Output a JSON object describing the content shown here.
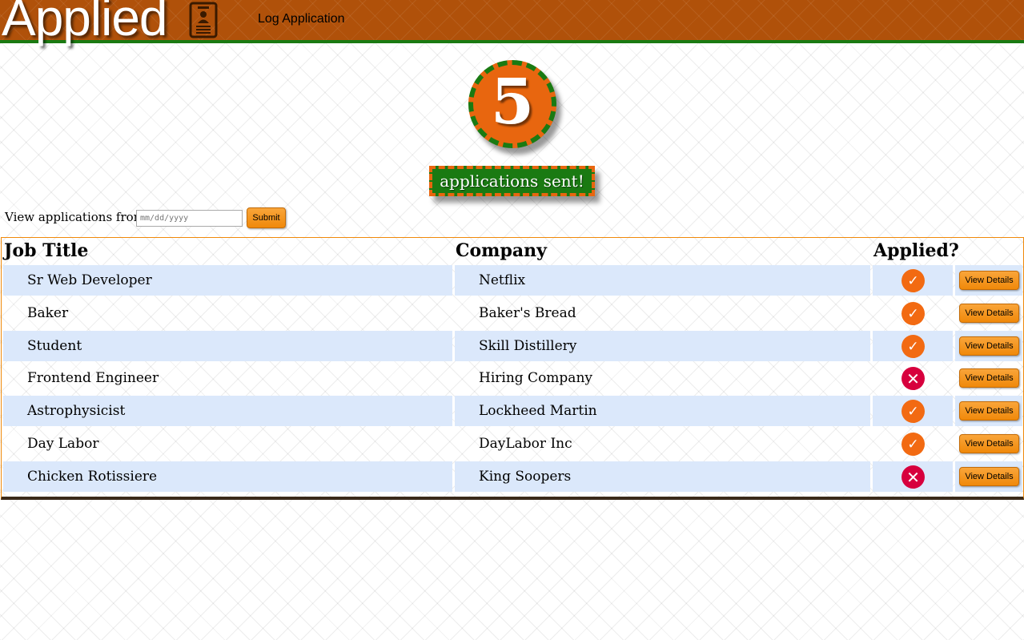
{
  "navbar": {
    "brand": "Applied",
    "brand_icon": "id-badge-icon",
    "log_link": "Log Application"
  },
  "summary": {
    "count": "5",
    "sent_text": "applications sent!"
  },
  "filter": {
    "label": "View applications from:",
    "date_placeholder": "mm/dd/yyyy",
    "submit_label": "Submit"
  },
  "table": {
    "headers": {
      "job": "Job Title",
      "company": "Company",
      "applied": "Applied?"
    },
    "view_label": "View Details",
    "rows": [
      {
        "job": "Sr Web Developer",
        "company": "Netflix",
        "applied": true
      },
      {
        "job": "Baker",
        "company": "Baker's Bread",
        "applied": true
      },
      {
        "job": "Student",
        "company": "Skill Distillery",
        "applied": true
      },
      {
        "job": "Frontend Engineer",
        "company": "Hiring Company",
        "applied": false
      },
      {
        "job": "Astrophysicist",
        "company": "Lockheed Martin",
        "applied": true
      },
      {
        "job": "Day Labor",
        "company": "DayLabor Inc",
        "applied": true
      },
      {
        "job": "Chicken Rotissiere",
        "company": "King Soopers",
        "applied": false
      }
    ]
  },
  "colors": {
    "navbar": "#b0510a",
    "accent_orange": "#e8660f",
    "accent_green": "#1a7a12",
    "row_shade": "#dbe8fb",
    "applied_yes": "#f26a12",
    "applied_no": "#d7003d"
  }
}
